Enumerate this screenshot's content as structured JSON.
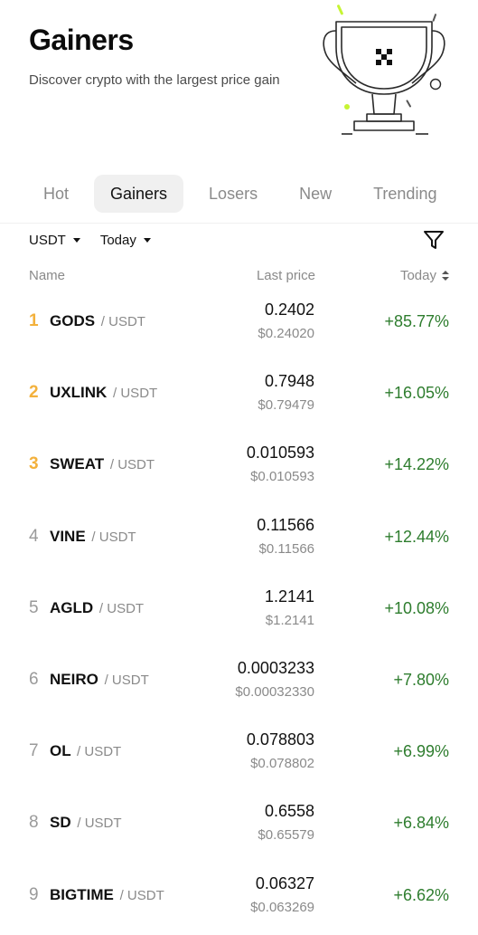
{
  "header": {
    "title": "Gainers",
    "description": "Discover crypto with the largest price gain"
  },
  "tabs": [
    {
      "label": "Hot",
      "active": false
    },
    {
      "label": "Gainers",
      "active": true
    },
    {
      "label": "Losers",
      "active": false
    },
    {
      "label": "New",
      "active": false
    },
    {
      "label": "Trending",
      "active": false
    }
  ],
  "filters": {
    "currency": "USDT",
    "period": "Today"
  },
  "columns": {
    "name": "Name",
    "price": "Last price",
    "change": "Today"
  },
  "colors": {
    "positive": "#2e7d2e",
    "rank_highlight": "#f3b13c",
    "accent": "#c6f432"
  },
  "icons": {
    "trophy": "trophy-illustration",
    "filter": "filter-icon",
    "sort": "sort-icon"
  },
  "rows": [
    {
      "rank": "1",
      "symbol": "GODS",
      "quote": "/ USDT",
      "price": "0.2402",
      "usd": "$0.24020",
      "change": "+85.77%"
    },
    {
      "rank": "2",
      "symbol": "UXLINK",
      "quote": "/ USDT",
      "price": "0.7948",
      "usd": "$0.79479",
      "change": "+16.05%"
    },
    {
      "rank": "3",
      "symbol": "SWEAT",
      "quote": "/ USDT",
      "price": "0.010593",
      "usd": "$0.010593",
      "change": "+14.22%"
    },
    {
      "rank": "4",
      "symbol": "VINE",
      "quote": "/ USDT",
      "price": "0.11566",
      "usd": "$0.11566",
      "change": "+12.44%"
    },
    {
      "rank": "5",
      "symbol": "AGLD",
      "quote": "/ USDT",
      "price": "1.2141",
      "usd": "$1.2141",
      "change": "+10.08%"
    },
    {
      "rank": "6",
      "symbol": "NEIRO",
      "quote": "/ USDT",
      "price": "0.0003233",
      "usd": "$0.00032330",
      "change": "+7.80%"
    },
    {
      "rank": "7",
      "symbol": "OL",
      "quote": "/ USDT",
      "price": "0.078803",
      "usd": "$0.078802",
      "change": "+6.99%"
    },
    {
      "rank": "8",
      "symbol": "SD",
      "quote": "/ USDT",
      "price": "0.6558",
      "usd": "$0.65579",
      "change": "+6.84%"
    },
    {
      "rank": "9",
      "symbol": "BIGTIME",
      "quote": "/ USDT",
      "price": "0.06327",
      "usd": "$0.063269",
      "change": "+6.62%"
    }
  ]
}
